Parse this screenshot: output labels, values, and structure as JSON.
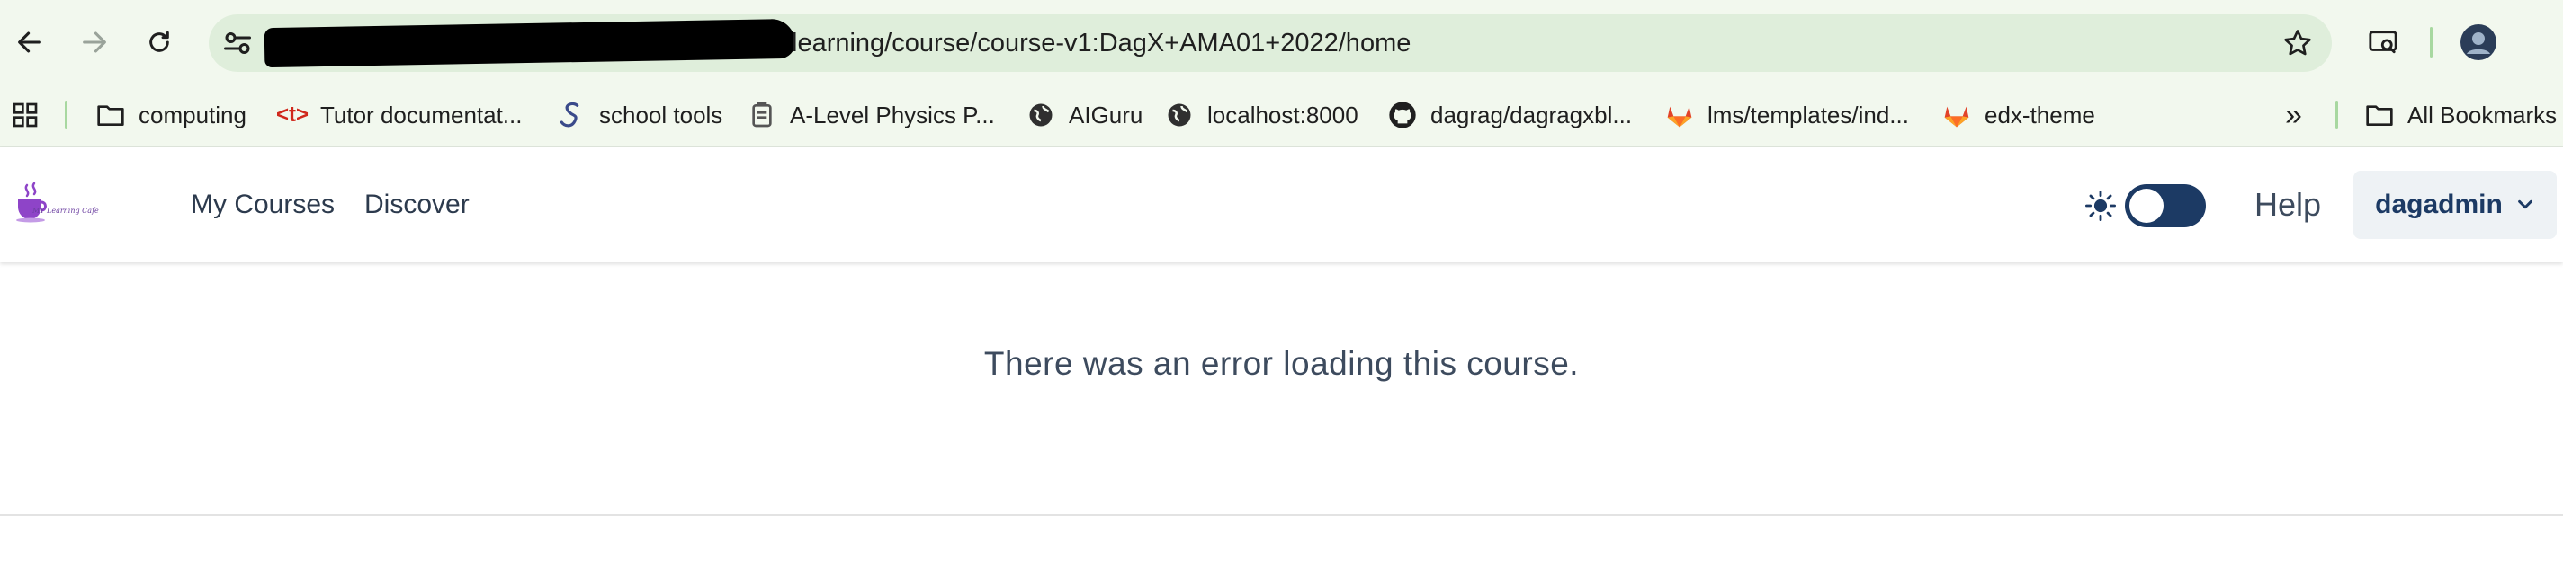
{
  "browser": {
    "url_visible": "learning/course/course-v1:DagX+AMA01+2022/home",
    "bookmarks": [
      {
        "label": "computing",
        "icon": "folder-icon"
      },
      {
        "label": "Tutor documentat...",
        "icon": "tutor-icon"
      },
      {
        "label": "school tools",
        "icon": "school-tools-icon"
      },
      {
        "label": "A-Level Physics P...",
        "icon": "physics-icon"
      },
      {
        "label": "AIGuru",
        "icon": "globe-icon"
      },
      {
        "label": "localhost:8000",
        "icon": "globe-icon"
      },
      {
        "label": "dagrag/dagragxbl...",
        "icon": "github-icon"
      },
      {
        "label": "lms/templates/ind...",
        "icon": "gitlab-icon"
      },
      {
        "label": "edx-theme",
        "icon": "gitlab-icon"
      }
    ],
    "overflow_label": "»",
    "all_bookmarks_label": "All Bookmarks"
  },
  "header": {
    "logo_text": "MY Learning Cafe",
    "nav": [
      {
        "label": "My Courses"
      },
      {
        "label": "Discover"
      }
    ],
    "help_label": "Help",
    "username": "dagadmin"
  },
  "main": {
    "error_message": "There was an error loading this course."
  },
  "colors": {
    "chrome_bg": "#f2f8ee",
    "omnibox_bg": "#dfeedb",
    "toggle": "#1c3a64",
    "text": "#3d4b5e"
  }
}
